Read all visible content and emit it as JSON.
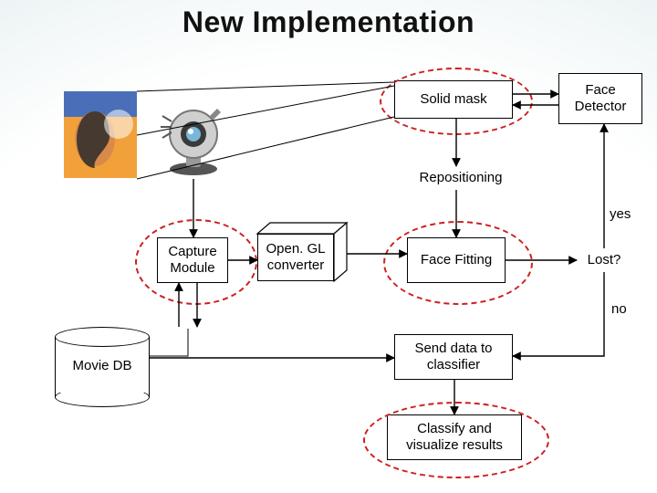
{
  "title": "New Implementation",
  "nodes": {
    "solid_mask": "Solid mask",
    "face_detector": "Face Detector",
    "repositioning": "Repositioning",
    "capture_module": "Capture Module",
    "opengl_converter": "Open. GL converter",
    "face_fitting": "Face Fitting",
    "lost": "Lost?",
    "send_to_classifier": "Send data to classifier",
    "classify_results": "Classify and visualize results",
    "movie_db": "Movie DB"
  },
  "edge_labels": {
    "yes": "yes",
    "no": "no"
  },
  "images": {
    "face_thumb": "face-profile-photo",
    "webcam": "webcam-clipart"
  }
}
